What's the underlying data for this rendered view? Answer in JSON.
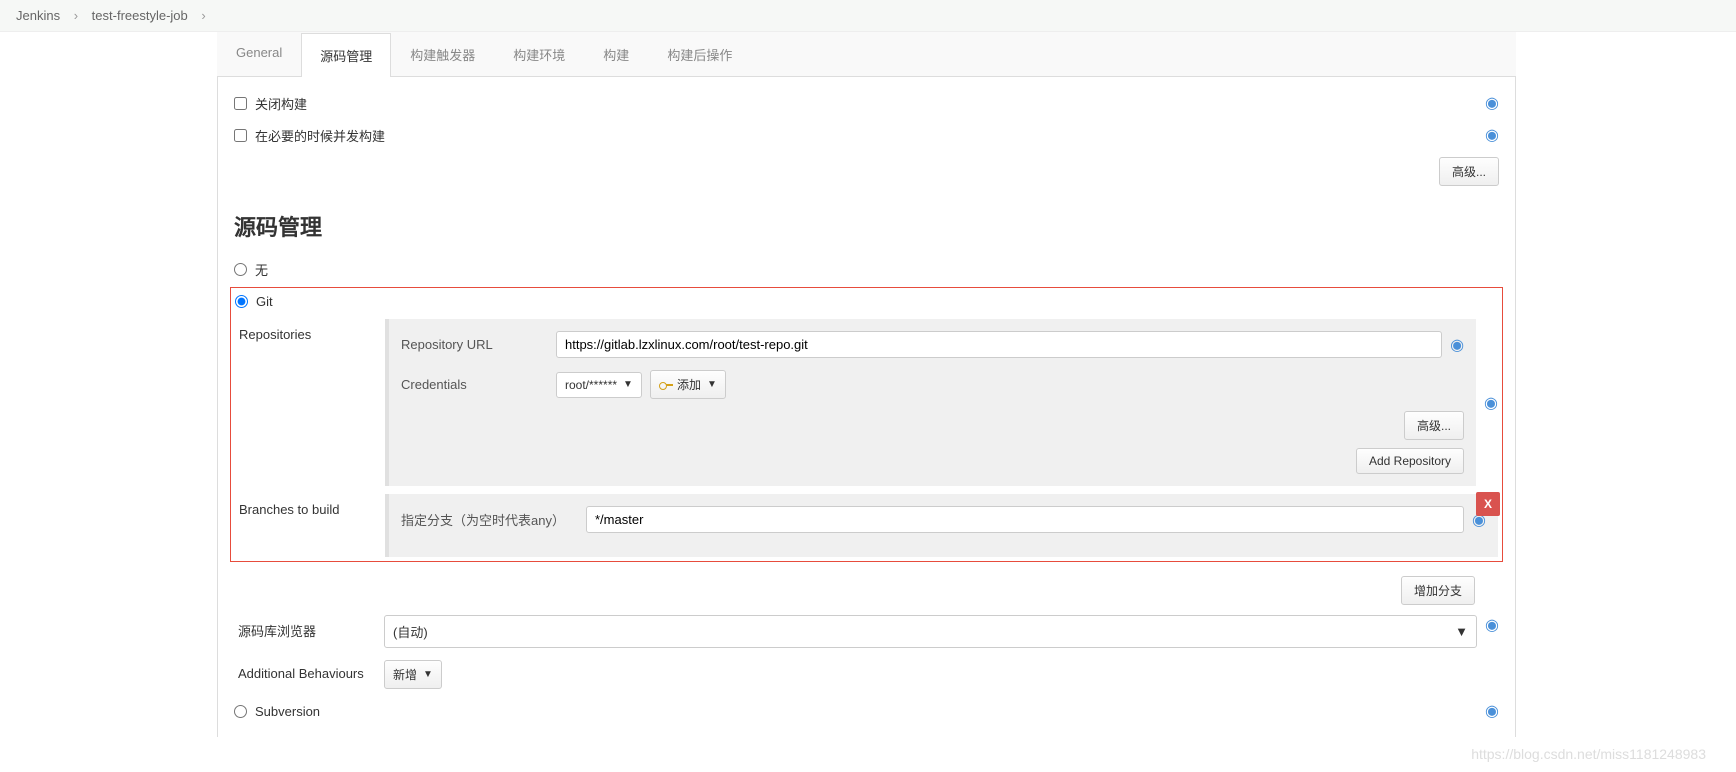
{
  "breadcrumb": {
    "root": "Jenkins",
    "job": "test-freestyle-job"
  },
  "tabs": [
    "General",
    "源码管理",
    "构建触发器",
    "构建环境",
    "构建",
    "构建后操作"
  ],
  "activeTab": 1,
  "options": {
    "disableBuild": "关闭构建",
    "concurrent": "在必要的时候并发构建"
  },
  "advancedBtn": "高级...",
  "scm": {
    "heading": "源码管理",
    "none": "无",
    "git": "Git",
    "subversion": "Subversion",
    "repositories": {
      "label": "Repositories",
      "urlLabel": "Repository URL",
      "urlValue": "https://gitlab.lzxlinux.com/root/test-repo.git",
      "credLabel": "Credentials",
      "credValue": "root/******",
      "addBtn": "添加",
      "advanced": "高级...",
      "addRepo": "Add Repository"
    },
    "branches": {
      "label": "Branches to build",
      "specLabel": "指定分支（为空时代表any）",
      "specValue": "*/master",
      "addBranch": "增加分支",
      "deleteIcon": "X"
    },
    "browser": {
      "label": "源码库浏览器",
      "value": "(自动)"
    },
    "additional": {
      "label": "Additional Behaviours",
      "btn": "新增"
    }
  },
  "watermark": "https://blog.csdn.net/miss1181248983"
}
